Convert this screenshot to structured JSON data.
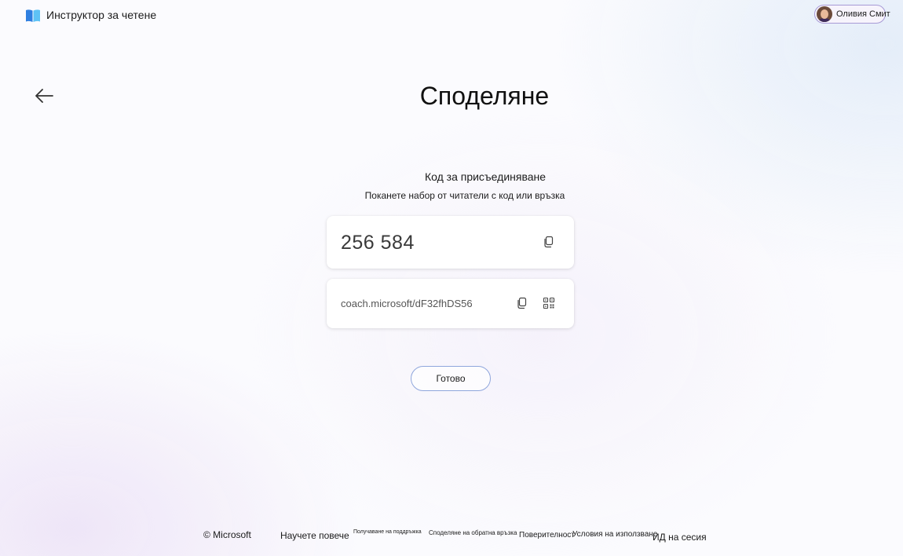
{
  "header": {
    "app_title": "Инструктор за четене",
    "user_name": "Оливия Смит"
  },
  "page": {
    "title": "Споделяне"
  },
  "join": {
    "heading": "Код за присъединяване",
    "subheading": "Поканете набор от читатели с код или връзка",
    "code": "256 584",
    "link": "coach.microsoft/dF32fhDS56"
  },
  "actions": {
    "done_label": "Готово"
  },
  "footer": {
    "copyright": "© Microsoft",
    "learn_more": "Научете повече",
    "get_support": "Получаване на поддръжка",
    "share_feedback": "Споделяне на обратна връзка",
    "privacy": "Поверителност",
    "terms": "Условия на използване",
    "session_id": "ИД на сесия"
  },
  "colors": {
    "accent_border": "#8fa6dc",
    "logo_blue": "#2f7fe0",
    "logo_light": "#5ec2f5"
  },
  "icons": {
    "logo": "book-icon",
    "back": "arrow-left-icon",
    "copy": "copy-icon",
    "qr": "qr-code-icon"
  }
}
